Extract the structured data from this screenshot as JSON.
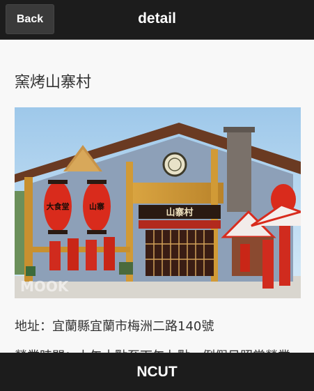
{
  "header": {
    "back_label": "Back",
    "title": "detail"
  },
  "store": {
    "name": "窯烤山寨村",
    "address": "地址：宜蘭縣宜蘭市梅洲二路140號",
    "description_partial": "營業時間：上午十點至下午七點，例假日照常營業"
  },
  "photo": {
    "sign_text": "山寨村",
    "lantern_left": "大食堂",
    "lantern_right": "山寨",
    "watermark": "MOOK"
  },
  "footer": {
    "label": "NCUT"
  }
}
